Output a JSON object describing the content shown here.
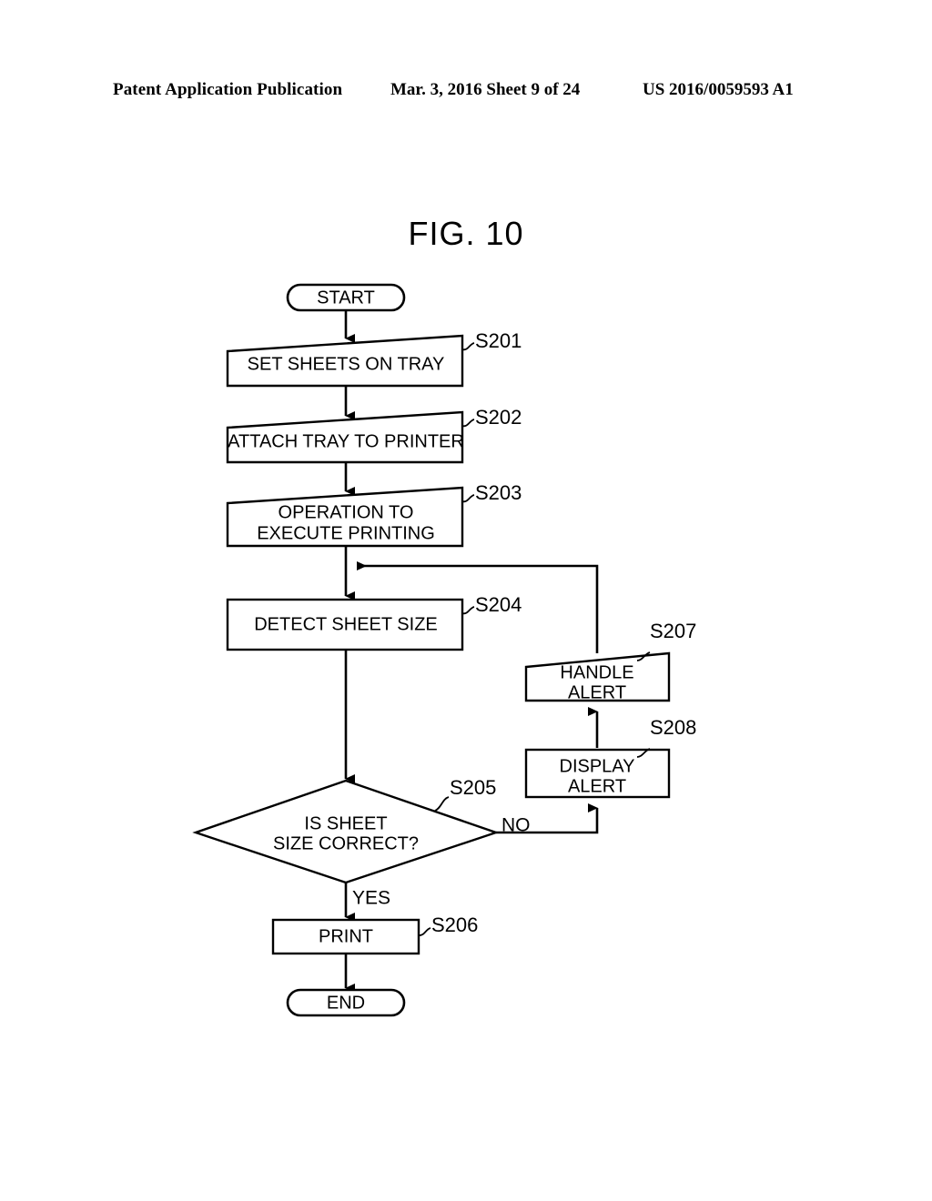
{
  "header": {
    "left": "Patent Application Publication",
    "middle": "Mar. 3, 2016  Sheet 9 of 24",
    "right": "US 2016/0059593 A1"
  },
  "figure": {
    "title": "FIG. 10"
  },
  "flowchart": {
    "start": {
      "label": "START"
    },
    "end": {
      "label": "END"
    },
    "s201": {
      "label": "SET SHEETS ON TRAY",
      "step": "S201"
    },
    "s202": {
      "label": "ATTACH TRAY TO PRINTER",
      "step": "S202"
    },
    "s203": {
      "label_line1": "OPERATION TO",
      "label_line2": "EXECUTE PRINTING",
      "step": "S203"
    },
    "s204": {
      "label": "DETECT SHEET SIZE",
      "step": "S204"
    },
    "s205": {
      "label_line1": "IS SHEET",
      "label_line2": "SIZE CORRECT?",
      "step": "S205",
      "yes": "YES",
      "no": "NO"
    },
    "s206": {
      "label": "PRINT",
      "step": "S206"
    },
    "s207": {
      "label_line1": "HANDLE",
      "label_line2": "ALERT",
      "step": "S207"
    },
    "s208": {
      "label_line1": "DISPLAY",
      "label_line2": "ALERT",
      "step": "S208"
    }
  },
  "colors": {
    "ink": "#000000",
    "paper": "#ffffff"
  }
}
